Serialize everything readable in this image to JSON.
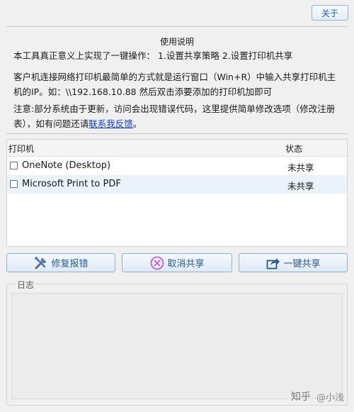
{
  "header": {
    "about_label": "关于"
  },
  "instructions": {
    "title": "使用说明",
    "line1": "本工具真正意义上实现了一键操作： 1.设置共享策略 2.设置打印机共享",
    "line2": "客户机连接网络打印机最简单的方式就是运行窗口（Win+R）中输入共享打印机主机的IP。如：\\\\192.168.10.88 然后双击添要添加的打印机加即可",
    "note_prefix": "注意:部分系统由于更新，访问会出现错误代码，这里提供简单修改选项（修改注册表），如有问题还请",
    "note_link": "联系我反馈",
    "note_suffix": "。"
  },
  "printers": {
    "col_name": "打印机",
    "col_status": "状态",
    "rows": [
      {
        "name": "OneNote (Desktop)",
        "status": "未共享",
        "checked": false
      },
      {
        "name": "Microsoft Print to PDF",
        "status": "未共享",
        "checked": false
      }
    ]
  },
  "actions": {
    "repair_label": "修复报错",
    "unshare_label": "取消共享",
    "share_label": "一键共享"
  },
  "log": {
    "legend": "日志"
  },
  "watermark": {
    "logo": "知乎",
    "user": "@小浅"
  },
  "colors": {
    "accent": "#1e5fa8",
    "link": "#0a3bd6",
    "row_alt": "#eaf3fb",
    "unshare_icon": "#c65bd3"
  }
}
